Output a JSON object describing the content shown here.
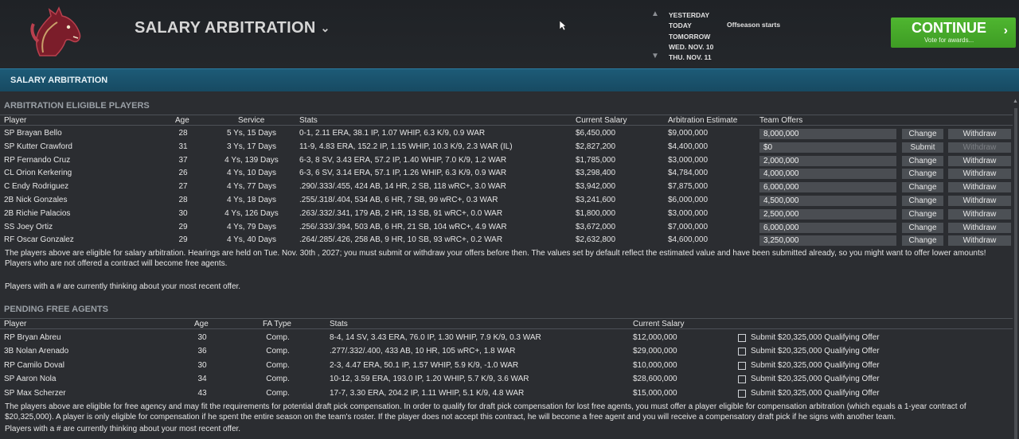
{
  "header": {
    "title": "SALARY ARBITRATION",
    "dates": [
      "YESTERDAY",
      "TODAY",
      "TOMORROW",
      "WED. NOV. 10",
      "THU. NOV. 11"
    ],
    "event": "Offseason starts",
    "continue_label": "CONTINUE",
    "continue_sub": "Vote for awards..."
  },
  "section_bar": "SALARY ARBITRATION",
  "arbitration": {
    "title": "ARBITRATION ELIGIBLE PLAYERS",
    "columns": [
      "Player",
      "Age",
      "Service",
      "Stats",
      "Current Salary",
      "Arbitration Estimate",
      "Team Offers"
    ],
    "rows": [
      {
        "player": "SP Brayan Bello",
        "age": "28",
        "service": "5 Ys, 15 Days",
        "stats": "0-1, 2.11 ERA, 38.1 IP, 1.07 WHIP, 6.3 K/9, 0.9 WAR",
        "salary": "$6,450,000",
        "estimate": "$9,000,000",
        "offer": "8,000,000",
        "btn1": "Change",
        "btn2": "Withdraw"
      },
      {
        "player": "SP Kutter Crawford",
        "age": "31",
        "service": "3 Ys, 17 Days",
        "stats": "11-9, 4.83 ERA, 152.2 IP, 1.15 WHIP, 10.3 K/9, 2.3 WAR (IL)",
        "salary": "$2,827,200",
        "estimate": "$4,400,000",
        "offer": "$0",
        "btn1": "Submit",
        "btn2": "Withdraw"
      },
      {
        "player": "RP Fernando Cruz",
        "age": "37",
        "service": "4 Ys, 139 Days",
        "stats": "6-3, 8 SV, 3.43 ERA, 57.2 IP, 1.40 WHIP, 7.0 K/9, 1.2 WAR",
        "salary": "$1,785,000",
        "estimate": "$3,000,000",
        "offer": "2,000,000",
        "btn1": "Change",
        "btn2": "Withdraw"
      },
      {
        "player": "CL Orion Kerkering",
        "age": "26",
        "service": "4 Ys, 10 Days",
        "stats": "6-3, 6 SV, 3.14 ERA, 57.1 IP, 1.26 WHIP, 6.3 K/9, 0.9 WAR",
        "salary": "$3,298,400",
        "estimate": "$4,784,000",
        "offer": "4,000,000",
        "btn1": "Change",
        "btn2": "Withdraw"
      },
      {
        "player": "C Endy Rodriguez",
        "age": "27",
        "service": "4 Ys, 77 Days",
        "stats": ".290/.333/.455, 424 AB, 14 HR, 2 SB, 118 wRC+, 3.0 WAR",
        "salary": "$3,942,000",
        "estimate": "$7,875,000",
        "offer": "6,000,000",
        "btn1": "Change",
        "btn2": "Withdraw"
      },
      {
        "player": "2B Nick Gonzales",
        "age": "28",
        "service": "4 Ys, 18 Days",
        "stats": ".255/.318/.404, 534 AB, 6 HR, 7 SB, 99 wRC+, 0.3 WAR",
        "salary": "$3,241,600",
        "estimate": "$6,000,000",
        "offer": "4,500,000",
        "btn1": "Change",
        "btn2": "Withdraw"
      },
      {
        "player": "2B Richie Palacios",
        "age": "30",
        "service": "4 Ys, 126 Days",
        "stats": ".263/.332/.341, 179 AB, 2 HR, 13 SB, 91 wRC+, 0.0 WAR",
        "salary": "$1,800,000",
        "estimate": "$3,000,000",
        "offer": "2,500,000",
        "btn1": "Change",
        "btn2": "Withdraw"
      },
      {
        "player": "SS Joey Ortiz",
        "age": "29",
        "service": "4 Ys, 79 Days",
        "stats": ".256/.333/.394, 503 AB, 6 HR, 21 SB, 104 wRC+, 4.9 WAR",
        "salary": "$3,672,000",
        "estimate": "$7,000,000",
        "offer": "6,000,000",
        "btn1": "Change",
        "btn2": "Withdraw"
      },
      {
        "player": "RF Oscar Gonzalez",
        "age": "29",
        "service": "4 Ys, 40 Days",
        "stats": ".264/.285/.426, 258 AB, 9 HR, 10 SB, 93 wRC+, 0.2 WAR",
        "salary": "$2,632,800",
        "estimate": "$4,600,000",
        "offer": "3,250,000",
        "btn1": "Change",
        "btn2": "Withdraw"
      }
    ],
    "note": "The players above are eligible for salary arbitration. Hearings are held on Tue. Nov. 30th , 2027; you must submit or withdraw your offers before then. The values set by default reflect the estimated value and have been submitted already, so you might want to offer lower amounts! Players who are not offered a contract will become free agents.",
    "note2": "Players with a # are currently thinking about your most recent offer."
  },
  "free_agents": {
    "title": "PENDING FREE AGENTS",
    "columns": [
      "Player",
      "Age",
      "FA Type",
      "Stats",
      "Current Salary"
    ],
    "rows": [
      {
        "player": "RP Bryan Abreu",
        "age": "30",
        "type": "Comp.",
        "stats": "8-4, 14 SV, 3.43 ERA, 76.0 IP, 1.30 WHIP, 7.9 K/9, 0.3 WAR",
        "salary": "$12,000,000",
        "offer": "Submit $20,325,000 Qualifying Offer"
      },
      {
        "player": "3B Nolan Arenado",
        "age": "36",
        "type": "Comp.",
        "stats": ".277/.332/.400, 433 AB, 10 HR, 105 wRC+, 1.8 WAR",
        "salary": "$29,000,000",
        "offer": "Submit $20,325,000 Qualifying Offer"
      },
      {
        "player": "RP Camilo Doval",
        "age": "30",
        "type": "Comp.",
        "stats": "2-3, 4.47 ERA, 50.1 IP, 1.57 WHIP, 5.9 K/9, -1.0 WAR",
        "salary": "$10,000,000",
        "offer": "Submit $20,325,000 Qualifying Offer"
      },
      {
        "player": "SP Aaron Nola",
        "age": "34",
        "type": "Comp.",
        "stats": "10-12, 3.59 ERA, 193.0 IP, 1.20 WHIP, 5.7 K/9, 3.6 WAR",
        "salary": "$28,600,000",
        "offer": "Submit $20,325,000 Qualifying Offer"
      },
      {
        "player": "SP Max Scherzer",
        "age": "43",
        "type": "Comp.",
        "stats": "17-7, 3.30 ERA, 204.2 IP, 1.11 WHIP, 5.1 K/9, 4.8 WAR",
        "salary": "$15,000,000",
        "offer": "Submit $20,325,000 Qualifying Offer"
      }
    ],
    "note": "The players above are eligible for free agency and may fit the requirements for potential draft pick compensation. In order to qualify for draft pick compensation for lost free agents, you must offer a player eligible for compensation arbitration (which equals a 1-year contract of $20,325,000). A player is only eligible for compensation if he spent the entire season on the team's roster. If the player does not accept this contract, he will become a free agent and you will receive a compensatory draft pick if he signs with another team.",
    "note2": "Players with a # are currently thinking about your most recent offer."
  },
  "colors": {
    "accent_green": "#46a82a",
    "section_blue": "#1d5b77",
    "logo_maroon": "#7b1d2a"
  }
}
